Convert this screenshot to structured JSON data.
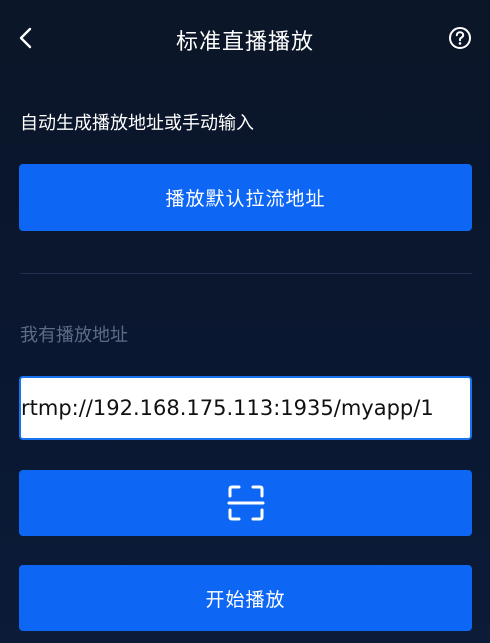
{
  "header": {
    "title": "标准直播播放",
    "back_icon": "chevron-left-icon",
    "help_icon": "question-circle-icon"
  },
  "auto_section": {
    "label": "自动生成播放地址或手动输入",
    "default_button_label": "播放默认拉流地址"
  },
  "manual_section": {
    "label": "我有播放地址",
    "url_value": "rtmp://192.168.175.113:1935/myapp/1",
    "scan_icon": "scan-icon",
    "start_button_label": "开始播放"
  },
  "colors": {
    "accent": "#0d67f4",
    "background": "#0b1628",
    "muted_text": "#5d6c86"
  }
}
